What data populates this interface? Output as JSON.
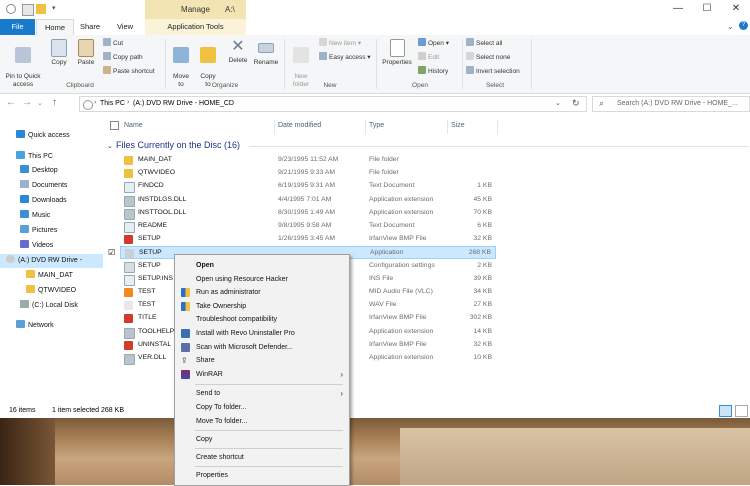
{
  "title_bar": {
    "manage_label": "Manage",
    "title": "A:\\"
  },
  "tabs": {
    "file": "File",
    "home": "Home",
    "share": "Share",
    "view": "View",
    "app_tools": "Application Tools"
  },
  "ribbon": {
    "pin_quick_access": "Pin to Quick\naccess",
    "copy": "Copy",
    "paste": "Paste",
    "cut": "Cut",
    "copy_path": "Copy path",
    "paste_shortcut": "Paste shortcut",
    "clipboard_group": "Clipboard",
    "move_to": "Move\nto",
    "copy_to": "Copy\nto",
    "delete": "Delete",
    "rename": "Rename",
    "organize_group": "Organize",
    "new_folder": "New\nfolder",
    "new_item": "New item",
    "easy_access": "Easy access",
    "new_group": "New",
    "properties": "Properties",
    "open": "Open",
    "edit": "Edit",
    "history": "History",
    "open_group": "Open",
    "select_all": "Select all",
    "select_none": "Select none",
    "invert_selection": "Invert selection",
    "select_group": "Select"
  },
  "address": {
    "this_pc": "This PC",
    "drive": "(A:) DVD RW Drive - HOME_CD",
    "search_placeholder": "Search (A:) DVD RW Drive - HOME_..."
  },
  "nav": {
    "quick_access": "Quick access",
    "this_pc": "This PC",
    "desktop": "Desktop",
    "documents": "Documents",
    "downloads": "Downloads",
    "music": "Music",
    "pictures": "Pictures",
    "videos": "Videos",
    "dvd_drive": "(A:) DVD RW Drive -",
    "main_dat": "MAIN_DAT",
    "qtwvideo": "QTWVIDEO",
    "local_disk": "(C:) Local Disk",
    "network": "Network"
  },
  "columns": {
    "name": "Name",
    "date": "Date modified",
    "type": "Type",
    "size": "Size"
  },
  "group_header": "Files Currently on the Disc (16)",
  "files": [
    {
      "name": "MAIN_DAT",
      "date": "9/23/1995 11:52 AM",
      "type": "File folder",
      "size": ""
    },
    {
      "name": "QTWVIDEO",
      "date": "9/21/1995 9:33 AM",
      "type": "File folder",
      "size": ""
    },
    {
      "name": "FINDCD",
      "date": "6/19/1995 9:31 AM",
      "type": "Text Document",
      "size": "1 KB"
    },
    {
      "name": "INSTDLGS.DLL",
      "date": "4/4/1995 7:01 AM",
      "type": "Application extension",
      "size": "45 KB"
    },
    {
      "name": "INSTTOOL.DLL",
      "date": "8/30/1995 1:49 AM",
      "type": "Application extension",
      "size": "70 KB"
    },
    {
      "name": "README",
      "date": "9/8/1995 9:58 AM",
      "type": "Text Document",
      "size": "6 KB"
    },
    {
      "name": "SETUP",
      "date": "1/26/1995 3:45 AM",
      "type": "IrfanView BMP File",
      "size": "32 KB"
    },
    {
      "name": "SETUP",
      "date": "",
      "type": "Application",
      "size": "268 KB"
    },
    {
      "name": "SETUP",
      "date": "",
      "type": "Configuration settings",
      "size": "2 KB"
    },
    {
      "name": "SETUP.INS",
      "date": "",
      "type": "INS File",
      "size": "39 KB"
    },
    {
      "name": "TEST",
      "date": "",
      "type": "MID Audio File (VLC)",
      "size": "34 KB"
    },
    {
      "name": "TEST",
      "date": "",
      "type": "WAV File",
      "size": "27 KB"
    },
    {
      "name": "TITLE",
      "date": "",
      "type": "IrfanView BMP File",
      "size": "302 KB"
    },
    {
      "name": "TOOLHELP",
      "date": "",
      "type": "Application extension",
      "size": "14 KB"
    },
    {
      "name": "UNINSTAL",
      "date": "",
      "type": "IrfanView BMP File",
      "size": "32 KB"
    },
    {
      "name": "VER.DLL",
      "date": "",
      "type": "Application extension",
      "size": "10 KB"
    }
  ],
  "status": {
    "count": "16 items",
    "selected": "1 item selected  268 KB"
  },
  "context_menu": {
    "open": "Open",
    "open_rh": "Open using Resource Hacker",
    "run_admin": "Run as administrator",
    "take_ownership": "Take Ownership",
    "troubleshoot": "Troubleshoot compatibility",
    "install_revo": "Install with Revo Uninstaller Pro",
    "scan_defender": "Scan with Microsoft Defender...",
    "share": "Share",
    "winrar": "WinRAR",
    "send_to": "Send to",
    "copy_to_folder": "Copy To folder...",
    "move_to_folder": "Move To folder...",
    "copy": "Copy",
    "create_shortcut": "Create shortcut",
    "properties": "Properties"
  },
  "colors": {
    "accent": "#1979ca",
    "selection": "#cce8ff",
    "folder": "#f0c040"
  }
}
